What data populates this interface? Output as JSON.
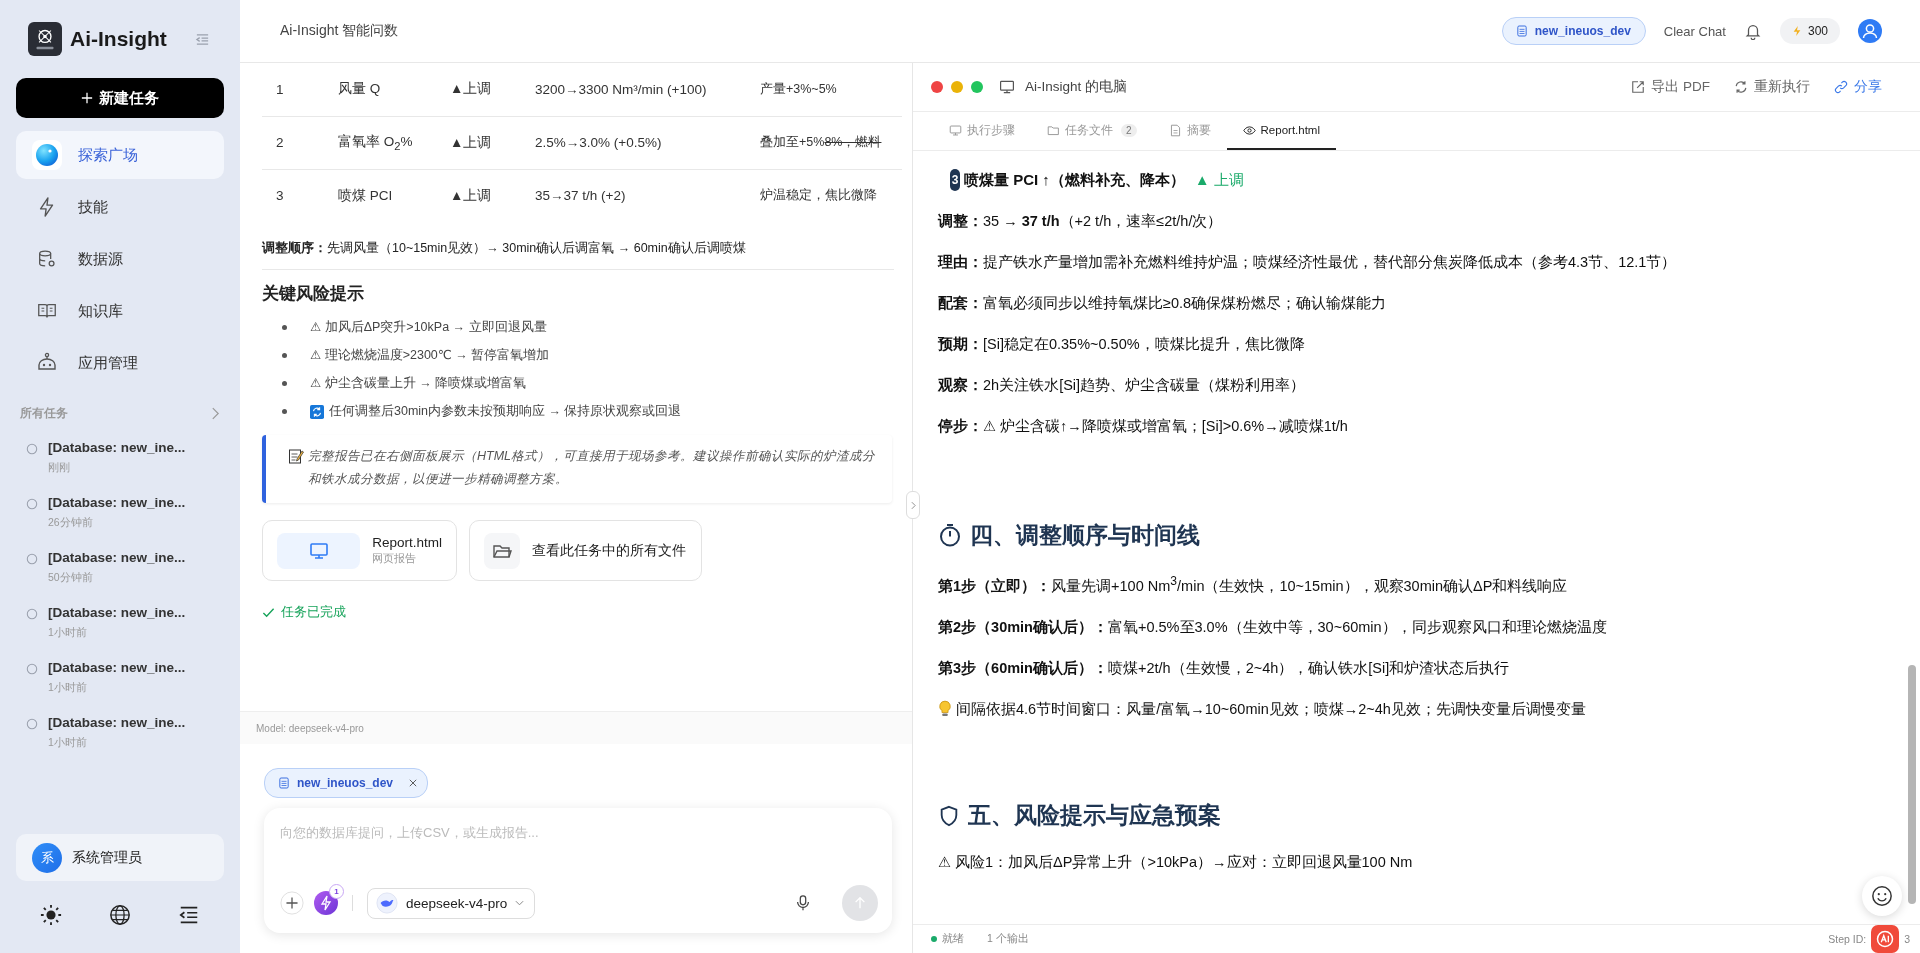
{
  "sidebar": {
    "app_name": "Ai-Insight",
    "new_task": "新建任务",
    "nav": [
      {
        "label": "探索广场",
        "selected": true
      },
      {
        "label": "技能",
        "selected": false
      },
      {
        "label": "数据源",
        "selected": false
      },
      {
        "label": "知识库",
        "selected": false
      },
      {
        "label": "应用管理",
        "selected": false
      }
    ],
    "tasks_header": "所有任务",
    "tasks": [
      {
        "title": "[Database: new_ine...",
        "time": "刚刚"
      },
      {
        "title": "[Database: new_ine...",
        "time": "26分钟前"
      },
      {
        "title": "[Database: new_ine...",
        "time": "50分钟前"
      },
      {
        "title": "[Database: new_ine...",
        "time": "1小时前"
      },
      {
        "title": "[Database: new_ine...",
        "time": "1小时前"
      },
      {
        "title": "[Database: new_ine...",
        "time": "1小时前"
      }
    ],
    "user": {
      "avatar": "系",
      "name": "系统管理员"
    }
  },
  "header": {
    "title": "Ai-Insight 智能问数",
    "db_chip": "new_ineuos_dev",
    "clear_chat": "Clear Chat",
    "credits": "300"
  },
  "chat": {
    "table": {
      "rows": [
        {
          "cells": [
            "1",
            "风量 Q",
            "▲上调",
            "3200→3300 Nm³/min (+100)",
            "产量+3%~5%"
          ]
        },
        {
          "cells": [
            "2",
            "富氧率 O$_{2}$%",
            "▲上调",
            "2.5%→3.0% (+0.5%)",
            "叠加至+5%"
          ],
          "struck": "8%，燃料"
        },
        {
          "cells": [
            "3",
            "喷煤 PCI",
            "▲上调",
            "35→37 t/h (+2)",
            "炉温稳定，焦比微降"
          ]
        }
      ]
    },
    "sequence": "**调整顺序：**先调风量（10~15min见效）→ 30min确认后调富氧 → 60min确认后调喷煤",
    "risk_heading": "关键风险提示",
    "risks": [
      {
        "kind": "plain",
        "text": "⚠ 加风后ΔP突升>10kPa → 立即回退风量"
      },
      {
        "kind": "plain",
        "text": "⚠ 理论燃烧温度>2300℃ → 暂停富氧增加"
      },
      {
        "kind": "plain",
        "text": "⚠ 炉尘含碳量上升 → 降喷煤或增富氧"
      },
      {
        "kind": "refresh",
        "text": "任何调整后30min内参数未按预期响应 → 保持原状观察或回退"
      }
    ],
    "note": "完整报告已在右侧面板展示（HTML格式），可直接用于现场参考。建议操作前确认实际的炉渣成分和铁水成分数据，以便进一步精确调整方案。",
    "files": [
      {
        "kind": "report",
        "name": "Report.html",
        "sub": "网页报告"
      },
      {
        "kind": "folder",
        "name": "查看此任务中的所有文件"
      }
    ],
    "status": "任务已完成",
    "model": "Model: deepseek-v4-pro",
    "chip": "new_ineuos_dev",
    "placeholder": "向您的数据库提问，上传CSV，或生成报告...",
    "skill_count": "1",
    "model_select": "deepseek-v4-pro"
  },
  "computer": {
    "title": "Ai-Insight 的电脑",
    "actions": [
      "导出 PDF",
      "重新执行",
      "分享"
    ],
    "tabs": [
      {
        "label": "执行步骤",
        "selected": false
      },
      {
        "label": "任务文件",
        "count": "2",
        "selected": false
      },
      {
        "label": "摘要",
        "selected": false
      },
      {
        "label": "Report.html",
        "selected": true
      }
    ],
    "report": {
      "section": {
        "number": "3",
        "title": "喷煤量 PCI ↑（燃料补充、降本）",
        "direction": "▲ 上调"
      },
      "lines": [
        "**调整：**35 → **37 t/h**（+2 t/h，速率≤2t/h/次）",
        "**理由：**提产铁水产量增加需补充燃料维持炉温；喷煤经济性最优，替代部分焦炭降低成本（参考4.3节、12.1节）",
        "**配套：**富氧必须同步以维持氧煤比≥0.8确保煤粉燃尽；确认输煤能力",
        "**预期：**[Si]稳定在0.35%~0.50%，喷煤比提升，焦比微降",
        "**观察：**2h关注铁水[Si]趋势、炉尘含碳量（煤粉利用率）",
        "**停步：**⚠ 炉尘含碳↑→降喷煤或增富氧；[Si]>0.6%→减喷煤1t/h"
      ],
      "timeline": {
        "heading": "四、调整顺序与时间线",
        "steps": [
          "**第1步（立即）：**风量先调+100 Nm$^{3}$/min（生效快，10~15min），观察30min确认ΔP和料线响应",
          "**第2步（30min确认后）：**富氧+0.5%至3.0%（生效中等，30~60min），同步观察风口和理论燃烧温度",
          "**第3步（60min确认后）：**喷煤+2t/h（生效慢，2~4h），确认铁水[Si]和炉渣状态后执行"
        ],
        "tip": "间隔依据4.6节时间窗口：风量/富氧→10~60min见效；喷煤→2~4h见效；先调快变量后调慢变量"
      },
      "risk": {
        "heading": "五、风险提示与应急预案",
        "lines": [
          "⚠ 风险1：加风后ΔP异常上升（>10kPa）→应对：立即回退风量100 Nm"
        ]
      }
    },
    "status": {
      "state": "就绪",
      "outputs": "1 个输出",
      "step": "Step ID:",
      "step_tail": "3"
    }
  }
}
